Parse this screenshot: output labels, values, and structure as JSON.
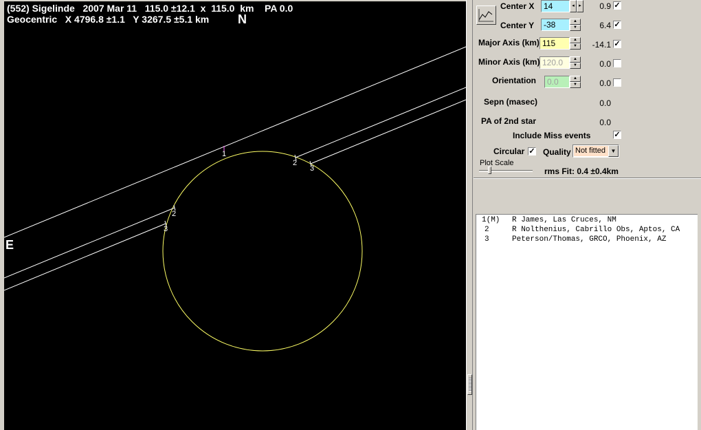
{
  "plot": {
    "title": "(552) Sigelinde   2007 Mar 11   115.0 ±12.1  x  115.0  km    PA 0.0",
    "subtitle": "Geocentric   X 4796.8 ±1.1   Y 3267.5 ±5.1 km",
    "north_label": "N",
    "east_label": "E",
    "chord_labels": [
      "1",
      "2",
      "3",
      "2",
      "3"
    ],
    "colors": {
      "background": "#000000",
      "outline": "#ffff66",
      "chords": "#ffffff",
      "miss_marker": "#ff66ff"
    }
  },
  "panel": {
    "center_x": {
      "label": "Center X",
      "value": "14",
      "offset": "0.9",
      "checked": true
    },
    "center_y": {
      "label": "Center Y",
      "value": "-38",
      "offset": "6.4",
      "checked": true
    },
    "major_axis": {
      "label": "Major Axis (km)",
      "value": "115",
      "offset": "-14.1",
      "checked": true
    },
    "minor_axis": {
      "label": "Minor Axis (km)",
      "value": "120.0",
      "offset": "0.0",
      "checked": false
    },
    "orientation": {
      "label": "Orientation",
      "value": "0.0",
      "offset": "0.0",
      "checked": false
    },
    "sepn": {
      "label": "Sepn (masec)",
      "value": "0.0"
    },
    "pa2": {
      "label": "PA of 2nd star",
      "value": "0.0"
    },
    "include_miss": {
      "label": "Include Miss events",
      "checked": true
    },
    "circular": {
      "label": "Circular",
      "checked": true
    },
    "quality": {
      "label": "Quality",
      "value": "Not fitted"
    },
    "plot_scale_label": "Plot Scale",
    "plot_scale_level": 0.17,
    "rms_fit": "rms Fit: 0.4 ±0.4km",
    "check_mark": "✓"
  },
  "observers": [
    {
      "num": "1(M)",
      "name": "R James, Las Cruces, NM"
    },
    {
      "num": "2",
      "name": "R Nolthenius, Cabrillo Obs, Aptos, CA"
    },
    {
      "num": "3",
      "name": "Peterson/Thomas, GRCO, Phoenix, AZ"
    }
  ]
}
